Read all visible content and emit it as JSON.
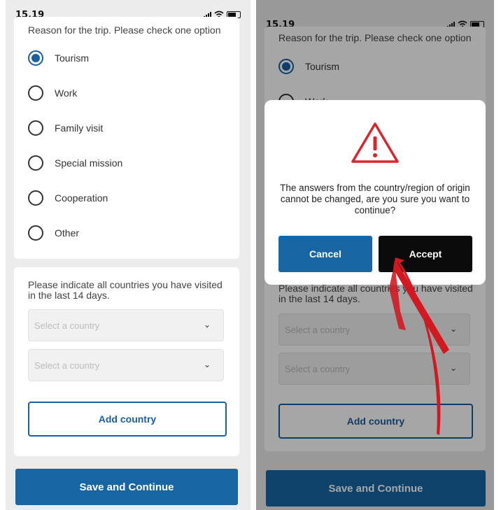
{
  "status": {
    "time": "15.19"
  },
  "form": {
    "trip_question": "Reason for the trip. Please check one option",
    "options": [
      "Tourism",
      "Work",
      "Family visit",
      "Special mission",
      "Cooperation",
      "Other"
    ],
    "selected": "Tourism",
    "countries_question": "Please indicate all countries you have visited in the last 14 days.",
    "select_placeholder": "Select a country",
    "add_country_label": "Add country",
    "save_label": "Save and Continue"
  },
  "dialog": {
    "message": "The answers from the country/region of origin cannot be changed, are you sure you want to continue?",
    "cancel_label": "Cancel",
    "accept_label": "Accept"
  },
  "colors": {
    "primary": "#1766a3",
    "accept": "#0b0b0b",
    "warning": "#d9262c",
    "arrow": "#d21922"
  }
}
